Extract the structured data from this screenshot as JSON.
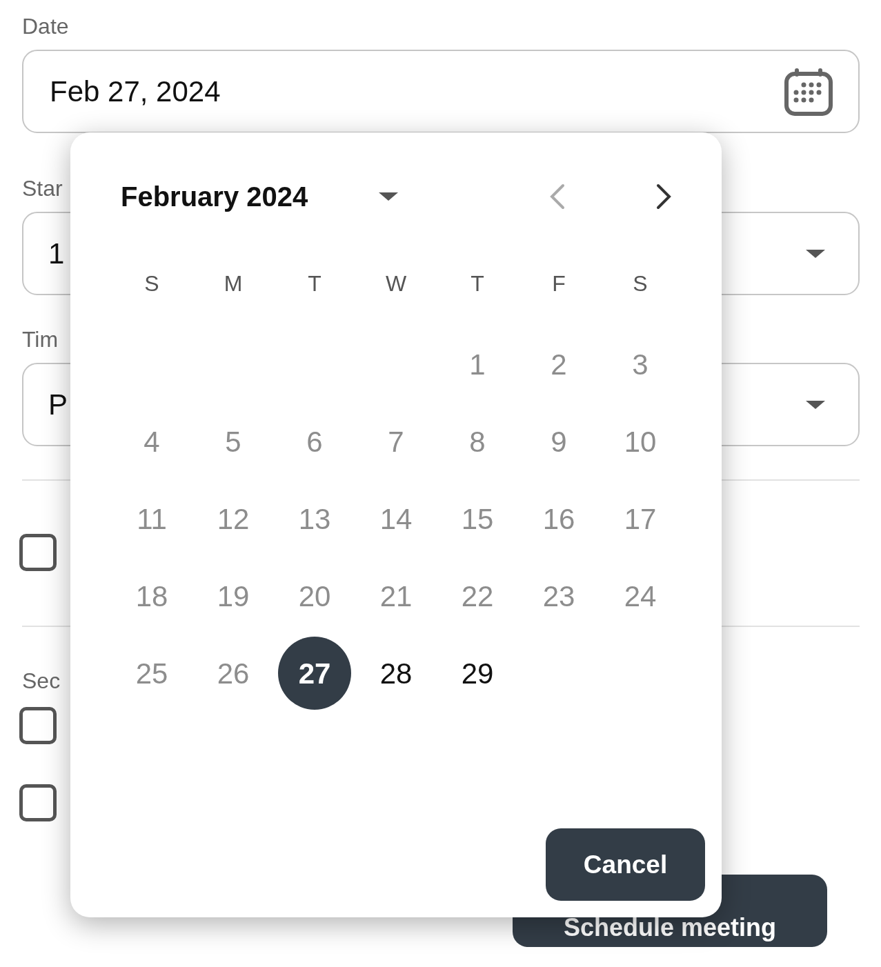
{
  "form": {
    "date": {
      "label": "Date",
      "value": "Feb 27, 2024"
    },
    "start": {
      "label": "Star",
      "value": "1"
    },
    "time": {
      "label": "Tim",
      "value": "P"
    },
    "option_checkbox": {
      "checked": false
    },
    "section": {
      "label": "Sec",
      "checkboxes": [
        {
          "checked": false
        },
        {
          "checked": false
        }
      ]
    },
    "submit_button": "Schedule meeting"
  },
  "calendar": {
    "month_label": "February 2024",
    "prev_disabled": true,
    "next_disabled": false,
    "weekdays": [
      "S",
      "M",
      "T",
      "W",
      "T",
      "F",
      "S"
    ],
    "weeks": [
      [
        {
          "label": "1",
          "disabled": true,
          "selected": false
        },
        {
          "label": "2",
          "disabled": true,
          "selected": false
        },
        {
          "label": "3",
          "disabled": true,
          "selected": false
        }
      ],
      [
        {
          "label": "4",
          "disabled": true,
          "selected": false
        },
        {
          "label": "5",
          "disabled": true,
          "selected": false
        },
        {
          "label": "6",
          "disabled": true,
          "selected": false
        },
        {
          "label": "7",
          "disabled": true,
          "selected": false
        },
        {
          "label": "8",
          "disabled": true,
          "selected": false
        },
        {
          "label": "9",
          "disabled": true,
          "selected": false
        },
        {
          "label": "10",
          "disabled": true,
          "selected": false
        }
      ],
      [
        {
          "label": "11",
          "disabled": true,
          "selected": false
        },
        {
          "label": "12",
          "disabled": true,
          "selected": false
        },
        {
          "label": "13",
          "disabled": true,
          "selected": false
        },
        {
          "label": "14",
          "disabled": true,
          "selected": false
        },
        {
          "label": "15",
          "disabled": true,
          "selected": false
        },
        {
          "label": "16",
          "disabled": true,
          "selected": false
        },
        {
          "label": "17",
          "disabled": true,
          "selected": false
        }
      ],
      [
        {
          "label": "18",
          "disabled": true,
          "selected": false
        },
        {
          "label": "19",
          "disabled": true,
          "selected": false
        },
        {
          "label": "20",
          "disabled": true,
          "selected": false
        },
        {
          "label": "21",
          "disabled": true,
          "selected": false
        },
        {
          "label": "22",
          "disabled": true,
          "selected": false
        },
        {
          "label": "23",
          "disabled": true,
          "selected": false
        },
        {
          "label": "24",
          "disabled": true,
          "selected": false
        }
      ],
      [
        {
          "label": "25",
          "disabled": true,
          "selected": false
        },
        {
          "label": "26",
          "disabled": true,
          "selected": false
        },
        {
          "label": "27",
          "disabled": false,
          "selected": true
        },
        {
          "label": "28",
          "disabled": false,
          "selected": false
        },
        {
          "label": "29",
          "disabled": false,
          "selected": false
        }
      ]
    ],
    "cancel_button": "Cancel"
  }
}
